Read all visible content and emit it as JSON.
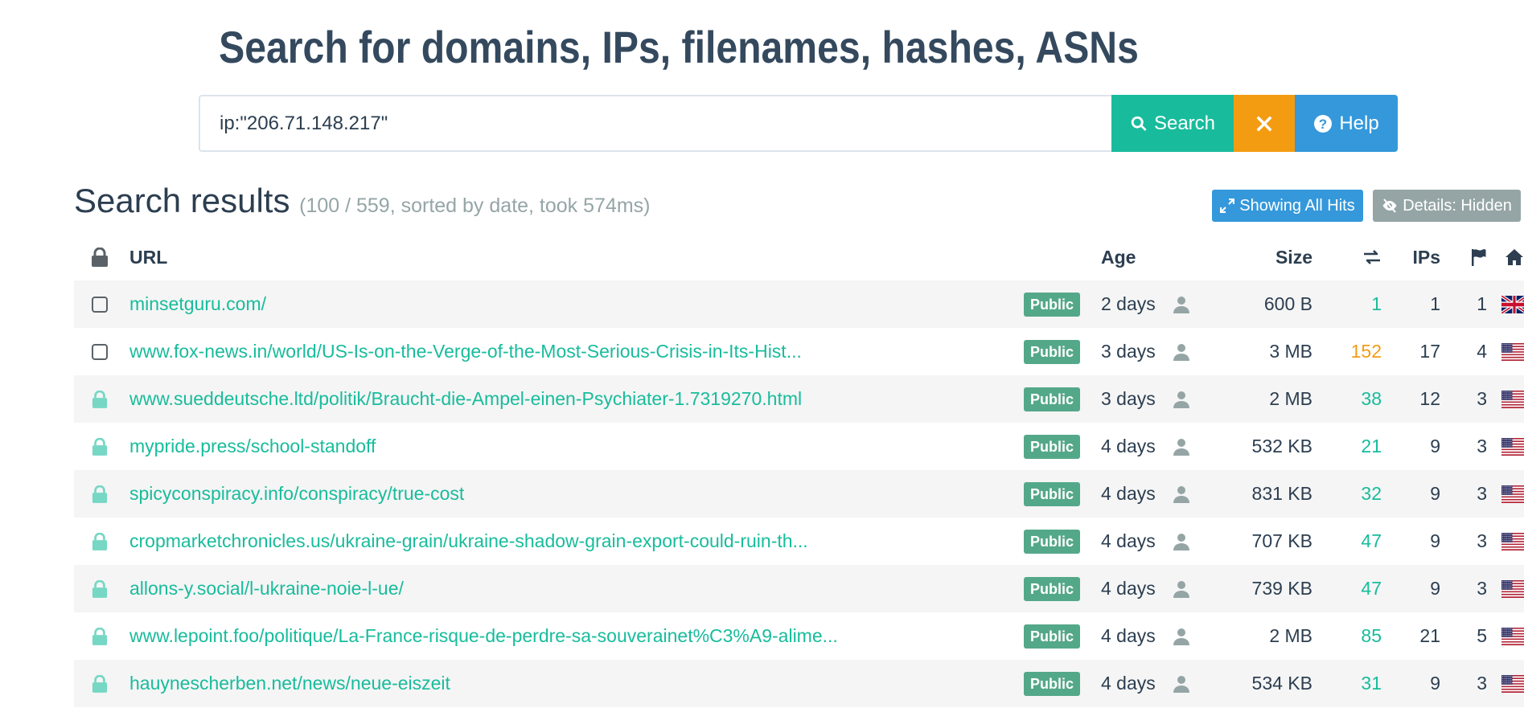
{
  "page": {
    "title": "Search for domains, IPs, filenames, hashes, ASNs"
  },
  "search": {
    "value": "ip:\"206.71.148.217\"",
    "search_label": "Search",
    "help_label": "Help",
    "clear_icon": "times-icon"
  },
  "results": {
    "title": "Search results",
    "meta": "(100 / 559, sorted by date, took 574ms)",
    "showing_all_hits_label": "Showing All Hits",
    "details_label": "Details: Hidden"
  },
  "columns": {
    "url": "URL",
    "age": "Age",
    "size": "Size",
    "ips": "IPs"
  },
  "colors": {
    "link": "#18bc9c",
    "warning": "#f39c12",
    "badge": "#54a88a",
    "primary": "#3498db",
    "muted": "#95a5a6"
  },
  "rows": [
    {
      "lock": "unchecked",
      "url": "minsetguru.com/",
      "visibility": "Public",
      "age": "2 days",
      "size": "600 B",
      "redirects": "1",
      "redirect_style": "link",
      "ips": "1",
      "countries": "1",
      "flag": "gb-flag-icon"
    },
    {
      "lock": "unchecked",
      "url": "www.fox-news.in/world/US-Is-on-the-Verge-of-the-Most-Serious-Crisis-in-Its-Hist...",
      "visibility": "Public",
      "age": "3 days",
      "size": "3 MB",
      "redirects": "152",
      "redirect_style": "warn",
      "ips": "17",
      "countries": "4",
      "flag": "us-flag-icon"
    },
    {
      "lock": "locked",
      "url": "www.sueddeutsche.ltd/politik/Braucht-die-Ampel-einen-Psychiater-1.7319270.html",
      "visibility": "Public",
      "age": "3 days",
      "size": "2 MB",
      "redirects": "38",
      "redirect_style": "link",
      "ips": "12",
      "countries": "3",
      "flag": "us-flag-icon"
    },
    {
      "lock": "locked",
      "url": "mypride.press/school-standoff",
      "visibility": "Public",
      "age": "4 days",
      "size": "532 KB",
      "redirects": "21",
      "redirect_style": "link",
      "ips": "9",
      "countries": "3",
      "flag": "us-flag-icon"
    },
    {
      "lock": "locked",
      "url": "spicyconspiracy.info/conspiracy/true-cost",
      "visibility": "Public",
      "age": "4 days",
      "size": "831 KB",
      "redirects": "32",
      "redirect_style": "link",
      "ips": "9",
      "countries": "3",
      "flag": "us-flag-icon"
    },
    {
      "lock": "locked",
      "url": "cropmarketchronicles.us/ukraine-grain/ukraine-shadow-grain-export-could-ruin-th...",
      "visibility": "Public",
      "age": "4 days",
      "size": "707 KB",
      "redirects": "47",
      "redirect_style": "link",
      "ips": "9",
      "countries": "3",
      "flag": "us-flag-icon"
    },
    {
      "lock": "locked",
      "url": "allons-y.social/l-ukraine-noie-l-ue/",
      "visibility": "Public",
      "age": "4 days",
      "size": "739 KB",
      "redirects": "47",
      "redirect_style": "link",
      "ips": "9",
      "countries": "3",
      "flag": "us-flag-icon"
    },
    {
      "lock": "locked",
      "url": "www.lepoint.foo/politique/La-France-risque-de-perdre-sa-souverainet%C3%A9-alime...",
      "visibility": "Public",
      "age": "4 days",
      "size": "2 MB",
      "redirects": "85",
      "redirect_style": "link",
      "ips": "21",
      "countries": "5",
      "flag": "us-flag-icon"
    },
    {
      "lock": "locked",
      "url": "hauynescherben.net/news/neue-eiszeit",
      "visibility": "Public",
      "age": "4 days",
      "size": "534 KB",
      "redirects": "31",
      "redirect_style": "link",
      "ips": "9",
      "countries": "3",
      "flag": "us-flag-icon"
    }
  ]
}
